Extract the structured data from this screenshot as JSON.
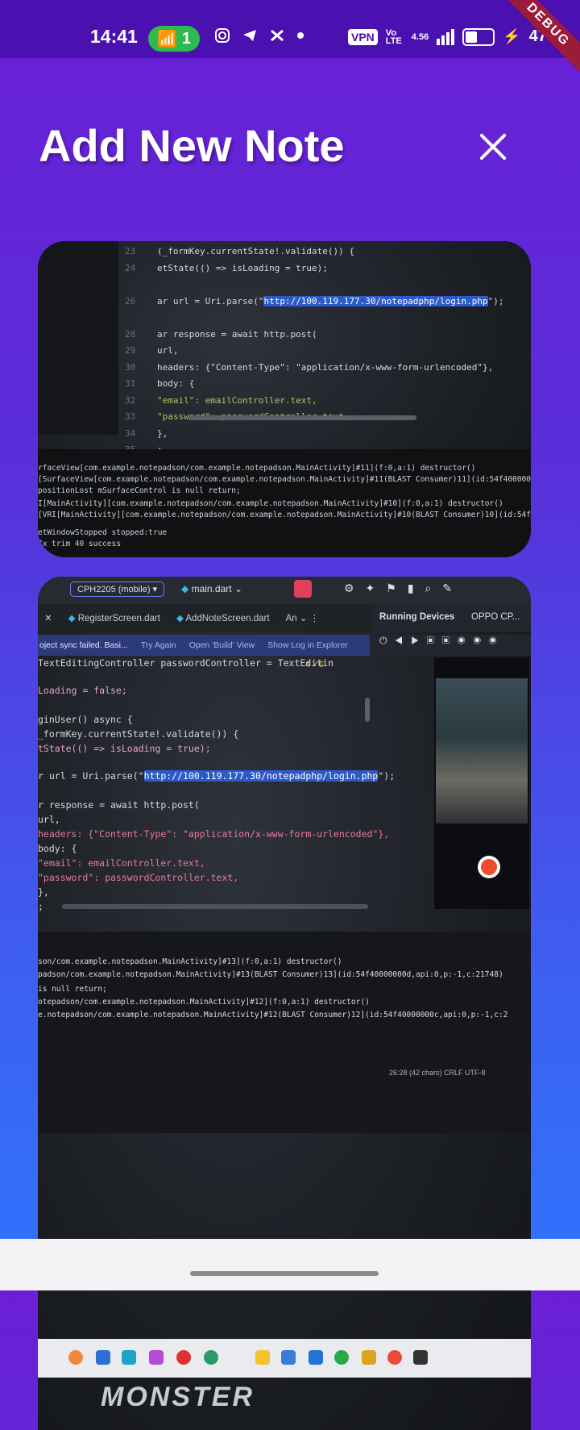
{
  "status_bar": {
    "time": "14:41",
    "hotspot_count": "1",
    "vpn": "VPN",
    "volte": "Vo LTE",
    "network": "4.56",
    "battery_percent": "47",
    "debug_banner": "DEBUG",
    "colors": {
      "bar": "#4a10b0",
      "pill": "#2dbb4e",
      "debug": "#9b1b3a"
    }
  },
  "header": {
    "title": "Add New Note",
    "close_icon": "close-icon"
  },
  "card1": {
    "code_lines": [
      {
        "num": "23",
        "text": "(_formKey.currentState!.validate()) {"
      },
      {
        "num": "24",
        "text": "etState(() => isLoading = true);"
      },
      {
        "num": "26",
        "text_before": "ar url = Uri.parse(\"",
        "url": "http://100.119.177.30/notepadphp/login.php",
        "text_after": "\");"
      },
      {
        "num": "28",
        "text": "ar response = await http.post("
      },
      {
        "num": "29",
        "text": "url,"
      },
      {
        "num": "30",
        "text": "headers: {\"Content-Type\": \"application/x-www-form-urlencoded\"},"
      },
      {
        "num": "31",
        "text": "body: {"
      },
      {
        "num": "32",
        "text": "\"email\": emailController.text,"
      },
      {
        "num": "33",
        "text": "\"password\": passwordController.text,"
      },
      {
        "num": "34",
        "text": "},"
      },
      {
        "num": "35",
        "text": ";"
      }
    ],
    "log_lines": [
      "rfaceView[com.example.notepadson/com.example.notepadson.MainActivity]#11](f:0,a:1) destructor()",
      "[SurfaceView[com.example.notepadson/com.example.notepadson.MainActivity]#11(BLAST Consumer)11](id:54f40000000",
      "positionLost mSurfaceControl is null return;",
      "I[MainActivity][com.example.notepadson/com.example.notepadson.MainActivity]#10](f:0,a:1) destructor()",
      "[VRI[MainActivity][com.example.notepadson/com.example.notepadson.MainActivity]#10(BLAST Consumer)10](id:54f40",
      "etWindowStopped stopped:true",
      "fx trim 40 success"
    ]
  },
  "card2": {
    "toolbar": {
      "device": "CPH2205 (mobile)",
      "file": "main.dart"
    },
    "tabs": [
      "RegisterScreen.dart",
      "AddNoteScreen.dart",
      "An"
    ],
    "running_devices": "Running Devices",
    "device_tab": "OPPO CP...",
    "sync_bar": {
      "message": "oject sync failed. Basi...",
      "try_again": "Try Again",
      "open_build": "Open 'Build' View",
      "show_log": "Show Log in Explorer"
    },
    "warnings": "4 ✓6",
    "code_lines": [
      "TextEditingController passwordController = TextEditin",
      "Loading = false;",
      "ginUser() async {",
      "_formKey.currentState!.validate()) {",
      "tState(() => isLoading = true);",
      "r url = Uri.parse(\"http://100.119.177.30/notepadphp/login.php\");",
      "r response = await http.post(",
      "url,",
      "headers: {\"Content-Type\": \"application/x-www-form-urlencoded\"},",
      "body: {",
      "\"email\": emailController.text,",
      "\"password\": passwordController.text,",
      "},",
      ";"
    ],
    "log_lines": [
      "son/com.example.notepadson.MainActivity]#13](f:0,a:1) destructor()",
      "padson/com.example.notepadson.MainActivity]#13(BLAST Consumer)13](id:54f40000000d,api:0,p:-1,c:21748)",
      "is null return;",
      "otepadson/com.example.notepadson.MainActivity]#12](f:0,a:1) destructor()",
      "e.notepadson/com.example.notepadson.MainActivity]#12(BLAST Consumer)12](id:54f40000000c,api:0,p:-1,c:2"
    ],
    "status_line": "26:28 (42 chars)  CRLF  UTF-8",
    "brand": "MONSTER"
  }
}
